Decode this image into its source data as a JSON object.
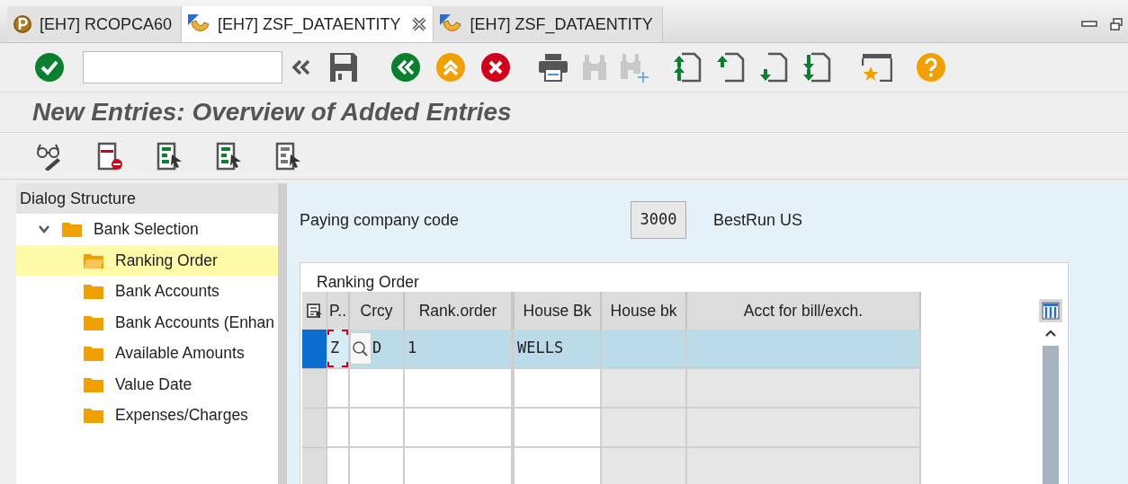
{
  "tabs": [
    {
      "label": "[EH7] RCOPCA60",
      "selected": false,
      "kind": "program"
    },
    {
      "label": "[EH7] ZSF_DATAENTITY",
      "selected": true,
      "kind": "transaction",
      "closable": true
    },
    {
      "label": "[EH7] ZSF_DATAENTITY",
      "selected": false,
      "kind": "transaction"
    }
  ],
  "title": "New Entries: Overview of Added Entries",
  "dialog_structure": {
    "title": "Dialog Structure",
    "items": [
      {
        "label": "Bank Selection",
        "expanded": true,
        "selected": false,
        "children": [
          {
            "label": "Ranking Order",
            "selected": true
          },
          {
            "label": "Bank Accounts",
            "selected": false
          },
          {
            "label": "Bank Accounts (Enhan",
            "selected": false
          },
          {
            "label": "Available Amounts",
            "selected": false
          },
          {
            "label": "Value Date",
            "selected": false
          },
          {
            "label": "Expenses/Charges",
            "selected": false
          }
        ]
      }
    ]
  },
  "header_field": {
    "label": "Paying company code",
    "value": "3000",
    "description": "BestRun US"
  },
  "table": {
    "title": "Ranking Order",
    "columns": [
      {
        "label": "P..",
        "editable": true
      },
      {
        "label": "Crcy",
        "editable": true
      },
      {
        "label": "Rank.order",
        "editable": true
      },
      {
        "label": "House Bk",
        "editable": true
      },
      {
        "label": "House bk",
        "editable": false
      },
      {
        "label": "Acct for bill/exch.",
        "editable": false
      }
    ],
    "rows": [
      {
        "selected": true,
        "cells": [
          "Z",
          "D",
          "1",
          "WELLS"
        ]
      },
      {
        "selected": false
      },
      {
        "selected": false
      },
      {
        "selected": false
      }
    ]
  }
}
